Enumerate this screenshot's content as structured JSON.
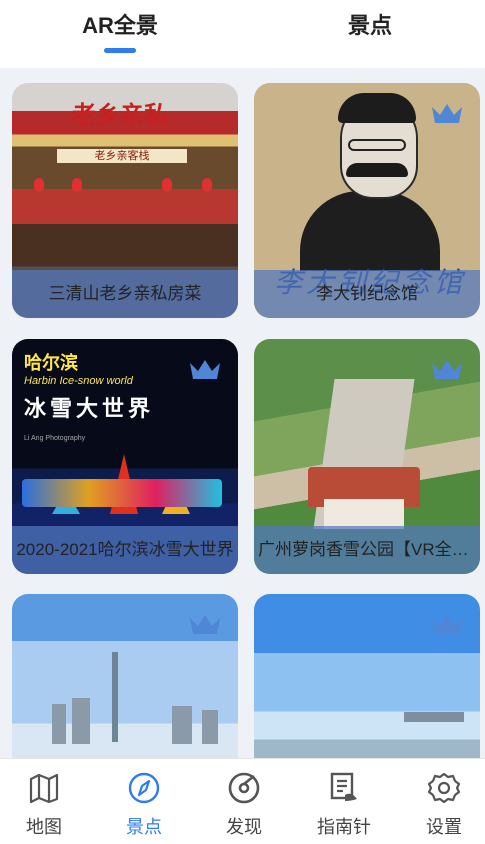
{
  "top_tabs": {
    "ar": "AR全景",
    "spots": "景点"
  },
  "cards": [
    {
      "caption": "三清山老乡亲私房菜",
      "premium": false,
      "sign_text": "老乡亲私",
      "panel_text": "老乡亲客栈"
    },
    {
      "caption": "李大钊纪念馆",
      "premium": true,
      "calligraphy": "李大钊纪念馆"
    },
    {
      "caption": "2020-2021哈尔滨冰雪大世界",
      "premium": true,
      "title_cn": "哈尔滨",
      "title_en": "Harbin Ice-snow world",
      "title_main": "冰雪大世界",
      "small_text": "Li Ang Photography"
    },
    {
      "caption": "广州萝岗香雪公园【VR全景】",
      "premium": true
    },
    {
      "caption": "",
      "premium": true
    },
    {
      "caption": "",
      "premium": true
    }
  ],
  "bottom_nav": [
    {
      "label": "地图",
      "icon": "map-icon",
      "active": false
    },
    {
      "label": "景点",
      "icon": "compass-icon",
      "active": true
    },
    {
      "label": "发现",
      "icon": "discover-icon",
      "active": false
    },
    {
      "label": "指南针",
      "icon": "guide-book-icon",
      "active": false
    },
    {
      "label": "设置",
      "icon": "settings-gear-icon",
      "active": false
    }
  ],
  "colors": {
    "accent": "#2f7bf0",
    "crown": "#4f86d6",
    "caption_overlay": "#5278be"
  }
}
